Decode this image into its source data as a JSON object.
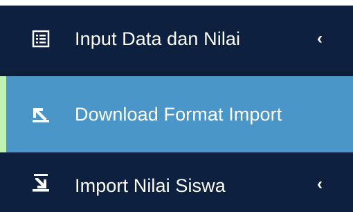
{
  "sidebar": {
    "items": [
      {
        "label": "Input Data dan Nilai",
        "icon": "list-document-icon",
        "chevron": "‹",
        "active": false
      },
      {
        "label": "Download Format Import",
        "icon": "download-icon",
        "active": true
      },
      {
        "label": "Import Nilai Siswa",
        "icon": "import-icon",
        "chevron": "‹",
        "active": false
      }
    ]
  },
  "colors": {
    "sidebar_bg": "#0d2040",
    "active_bg": "#4a96c8",
    "active_accent": "#bff3b4",
    "text": "#ffffff"
  }
}
